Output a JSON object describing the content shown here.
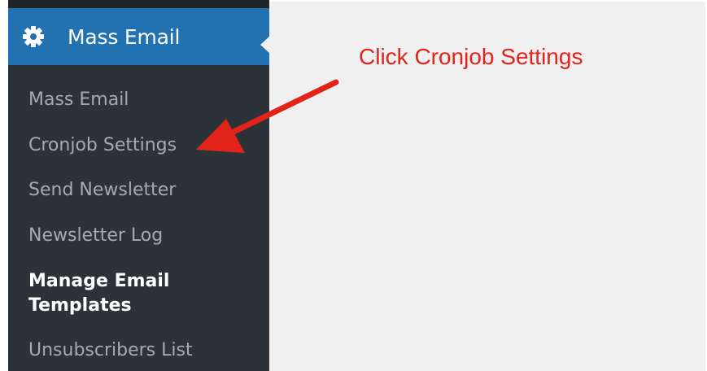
{
  "menu_header": {
    "title": "Mass Email",
    "icon": "gear-icon"
  },
  "submenu": {
    "items": [
      {
        "label": "Mass Email"
      },
      {
        "label": "Cronjob Settings"
      },
      {
        "label": "Send Newsletter"
      },
      {
        "label": "Newsletter Log"
      },
      {
        "label": "Manage Email Templates",
        "active": true
      },
      {
        "label": "Unsubscribers List"
      }
    ]
  },
  "annotation": {
    "text": "Click Cronjob Settings",
    "color": "#e2231a"
  },
  "colors": {
    "sidebar": "#2c3338",
    "menu_highlight": "#2271b1",
    "content_bg": "#f0f0f1"
  }
}
